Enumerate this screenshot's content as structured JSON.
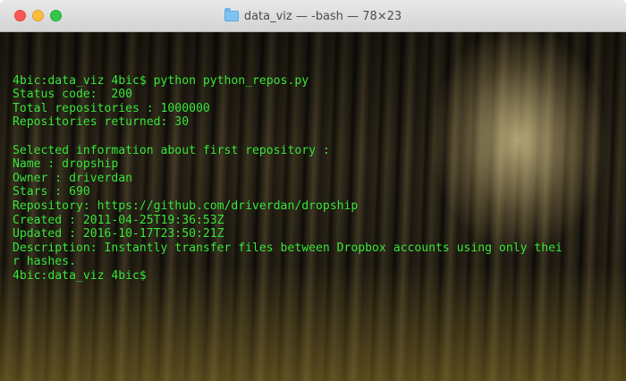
{
  "window": {
    "title": "data_viz — -bash — 78×23",
    "folder_icon": "folder-icon"
  },
  "terminal": {
    "text_color": "#3de83d",
    "lines": [
      "",
      "4bic:data_viz 4bic$ python python_repos.py",
      "Status code:  200",
      "Total repositories : 1000000",
      "Repositories returned: 30",
      "",
      "Selected information about first repository :",
      "Name : dropship",
      "Owner : driverdan",
      "Stars : 690",
      "Repository: https://github.com/driverdan/dropship",
      "Created : 2011-04-25T19:36:53Z",
      "Updated : 2016-10-17T23:50:21Z",
      "Description: Instantly transfer files between Dropbox accounts using only thei",
      "r hashes.",
      "4bic:data_viz 4bic$"
    ]
  }
}
